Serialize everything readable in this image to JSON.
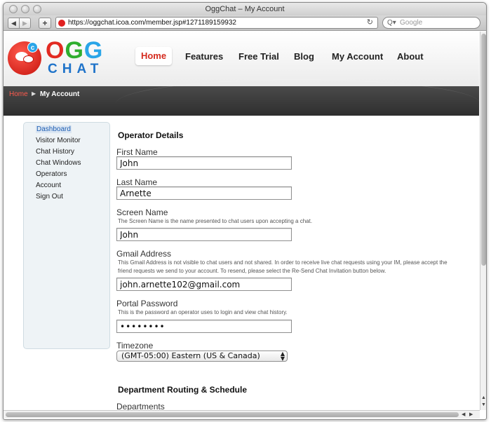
{
  "window": {
    "title": "OggChat – My Account"
  },
  "browser": {
    "url": "https://oggchat.icoa.com/member.jsp#1271189159932",
    "search_placeholder": "Google",
    "back_icon": "back-arrow-icon",
    "forward_icon": "forward-arrow-icon",
    "add_icon": "plus-icon",
    "reload_icon": "reload-icon"
  },
  "logo": {
    "top": "OGG",
    "bottom": "CHAT",
    "badge": "c"
  },
  "nav": {
    "items": [
      "Home",
      "Features",
      "Free Trial",
      "Blog",
      "My Account",
      "About"
    ],
    "active": "Home"
  },
  "breadcrumb": {
    "home": "Home",
    "current": "My Account"
  },
  "sidebar": {
    "items": [
      "Dashboard",
      "Visitor Monitor",
      "Chat History",
      "Chat Windows",
      "Operators",
      "Account",
      "Sign Out"
    ],
    "active": "Dashboard"
  },
  "form": {
    "title": "Operator Details",
    "first_name": {
      "label": "First Name",
      "value": "John"
    },
    "last_name": {
      "label": "Last Name",
      "value": "Arnette"
    },
    "screen_name": {
      "label": "Screen Name",
      "help": "The Screen Name is the name presented to chat users upon accepting a chat.",
      "value": "John"
    },
    "gmail": {
      "label": "Gmail Address",
      "help": "This Gmail Address is not visible to chat users and not shared. In order to receive live chat requests using your IM, please accept the friend requests we send to your account. To resend, please select the Re-Send Chat Invitation button below.",
      "value": "john.arnette102@gmail.com"
    },
    "password": {
      "label": "Portal Password",
      "help": "This is the password an operator uses to login and view chat history.",
      "value": "••••••••"
    },
    "timezone": {
      "label": "Timezone",
      "value": "(GMT-05:00) Eastern (US & Canada)"
    }
  },
  "routing": {
    "title": "Department Routing & Schedule",
    "departments_label": "Departments"
  },
  "colors": {
    "brand_red": "#e22a22",
    "brand_green": "#2fae2f",
    "brand_blue": "#2aa5e8",
    "active_link": "#1f5fb3"
  }
}
